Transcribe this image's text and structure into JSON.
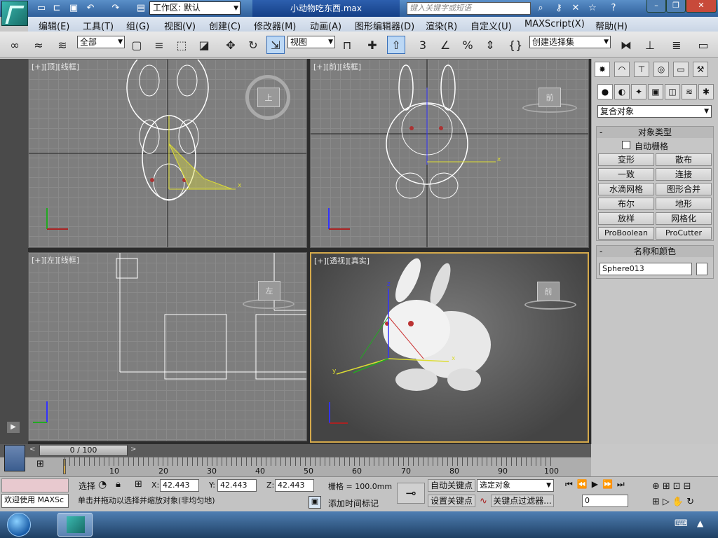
{
  "title_bar": {
    "workspace_label": "工作区: 默认",
    "document_title": "小动物吃东西.max",
    "search_placeholder": "键入关键字或短语"
  },
  "menu": [
    "编辑(E)",
    "工具(T)",
    "组(G)",
    "视图(V)",
    "创建(C)",
    "修改器(M)",
    "动画(A)",
    "图形编辑器(D)",
    "渲染(R)",
    "自定义(U)",
    "MAXScript(X)",
    "帮助(H)"
  ],
  "toolbar": {
    "selection_filter": "全部",
    "reference_coord": "视图",
    "named_selection": "创建选择集",
    "snap_value": "3",
    "percent_label": "%"
  },
  "viewports": {
    "top": {
      "plus": "[+]",
      "name": "[顶]",
      "mode": "[线框]",
      "cube": "上"
    },
    "front": {
      "plus": "[+]",
      "name": "[前]",
      "mode": "[线框]",
      "cube": "前"
    },
    "left": {
      "plus": "[+]",
      "name": "[左]",
      "mode": "[线框]",
      "cube": "左"
    },
    "persp": {
      "plus": "[+]",
      "name": "[透视]",
      "mode": "[真实]",
      "cube": "前"
    }
  },
  "command_panel": {
    "category": "复合对象",
    "object_type_title": "对象类型",
    "autogrid_label": "自动栅格",
    "buttons": [
      "变形",
      "散布",
      "一致",
      "连接",
      "水滴网格",
      "图形合并",
      "布尔",
      "地形",
      "放样",
      "网格化",
      "ProBoolean",
      "ProCutter"
    ],
    "name_color_title": "名称和颜色",
    "object_name": "Sphere013",
    "object_color": "#ffffff"
  },
  "timeline": {
    "frame_display": "0 / 100",
    "ticks": [
      "10",
      "20",
      "30",
      "40",
      "50",
      "60",
      "70",
      "80",
      "90",
      "100"
    ]
  },
  "status": {
    "welcome": "欢迎使用 MAXSc",
    "select_label": "选择",
    "x_label": "X:",
    "x_value": "42.443",
    "y_label": "Y:",
    "y_value": "42.443",
    "z_label": "Z:",
    "z_value": "42.443",
    "grid": "栅格 = 100.0mm",
    "prompt": "单击并拖动以选择并缩放对象(非均匀地)",
    "add_time_tag": "添加时间标记",
    "auto_key": "自动关键点",
    "set_key": "设置关键点",
    "key_mode": "选定对象",
    "key_filters": "关键点过滤器...",
    "frame": "0"
  }
}
